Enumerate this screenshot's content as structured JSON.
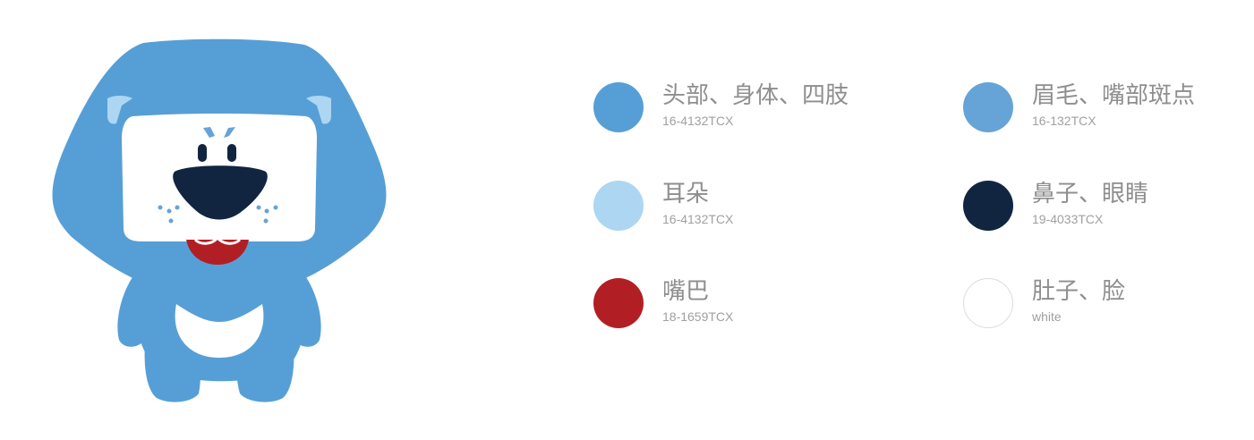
{
  "palette": {
    "left_column": [
      {
        "name": "头部、身体、四肢",
        "code": "16-4132TCX",
        "color": "#569fd6"
      },
      {
        "name": "耳朵",
        "code": "16-4132TCX",
        "color": "#acd6f2"
      },
      {
        "name": "嘴巴",
        "code": "18-1659TCX",
        "color": "#b11f24"
      }
    ],
    "right_column": [
      {
        "name": "眉毛、嘴部斑点",
        "code": "16-132TCX",
        "color": "#66a3d7"
      },
      {
        "name": "鼻子、眼睛",
        "code": "19-4033TCX",
        "color": "#112540"
      },
      {
        "name": "肚子、脸",
        "code": "white",
        "color": "#ffffff"
      }
    ]
  },
  "mascot": {
    "body_color": "#569fd6",
    "ear_color": "#acd6f2",
    "brow_color": "#66a3d7",
    "nose_color": "#112540",
    "mouth_color": "#b11f24",
    "face_color": "#ffffff"
  }
}
